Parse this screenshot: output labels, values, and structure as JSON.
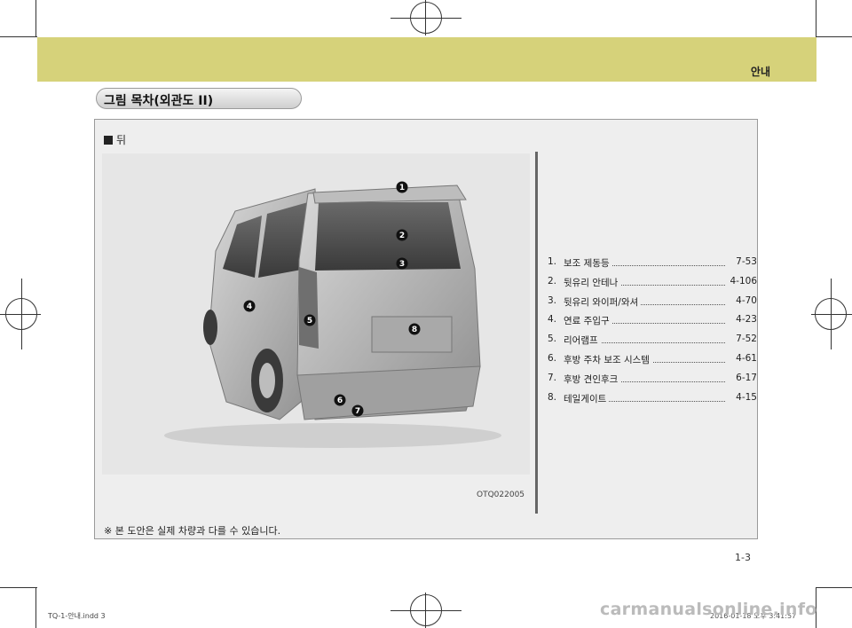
{
  "header": {
    "section_label": "안내"
  },
  "title": "그림 목차(외관도 II)",
  "section": {
    "heading": "뒤",
    "square_icon": "black-square"
  },
  "photo": {
    "code": "OTQ022005",
    "callouts": [
      "1",
      "2",
      "3",
      "4",
      "5",
      "6",
      "7",
      "8"
    ]
  },
  "legend": [
    {
      "num": "1.",
      "name": "보조 제동등",
      "page": "7-53"
    },
    {
      "num": "2.",
      "name": "뒷유리 안테나",
      "page": "4-106"
    },
    {
      "num": "3.",
      "name": "뒷유리 와이퍼/와셔",
      "page": "4-70"
    },
    {
      "num": "4.",
      "name": "연료 주입구",
      "page": "4-23"
    },
    {
      "num": "5.",
      "name": "리어램프",
      "page": "7-52"
    },
    {
      "num": "6.",
      "name": "후방 주차 보조 시스템",
      "page": "4-61"
    },
    {
      "num": "7.",
      "name": "후방 견인후크",
      "page": "6-17"
    },
    {
      "num": "8.",
      "name": "테일게이트",
      "page": "4-15"
    }
  ],
  "note": "※ 본 도안은 실제 차량과 다를 수 있습니다.",
  "page_number": "1-3",
  "footer": {
    "file": "TQ-1-안내.indd   3",
    "timestamp": "2016-01-18   오후 3:41:57"
  },
  "watermark": "carmanualsonline.info",
  "colors": {
    "header_band": "#d6d27a",
    "panel_bg": "#eeeeee",
    "panel_border": "#9a9a9a"
  }
}
